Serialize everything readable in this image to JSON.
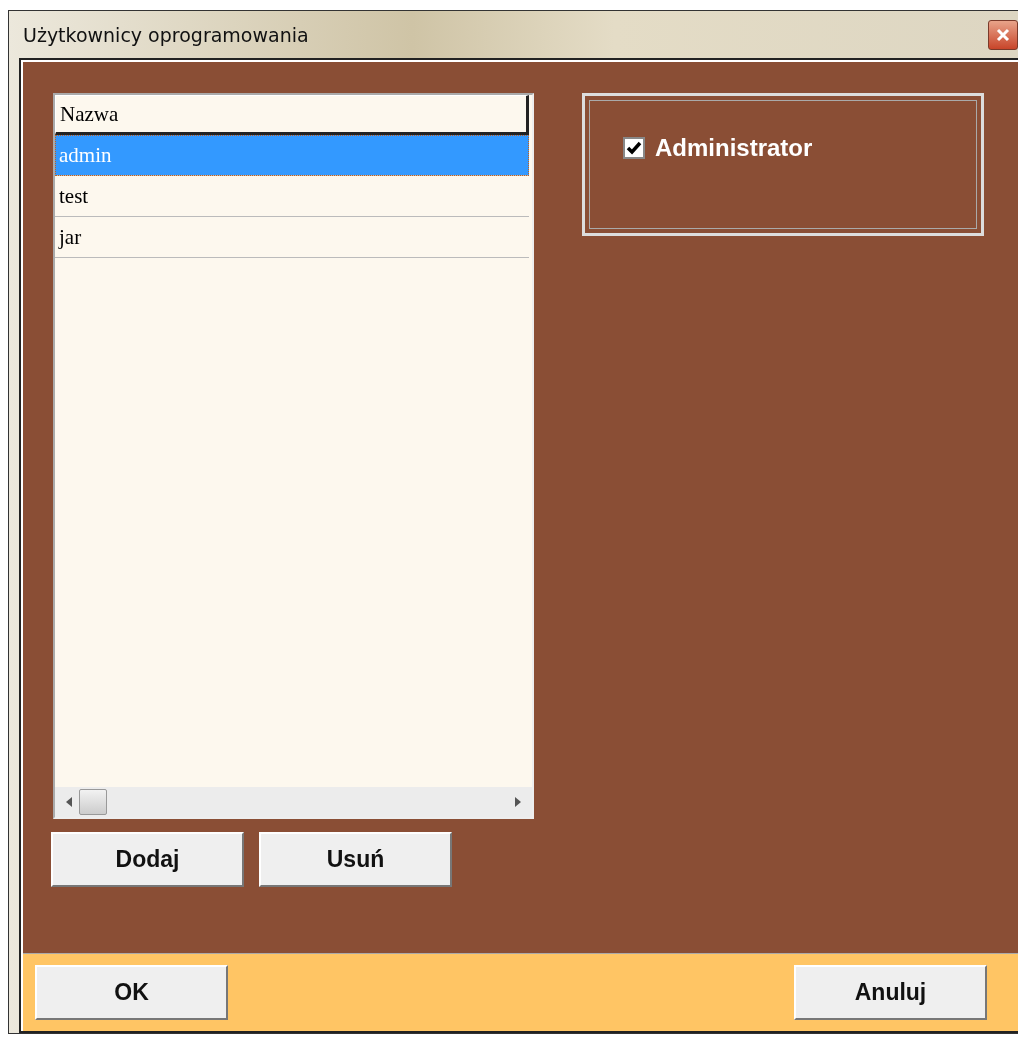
{
  "window": {
    "title": "Użytkownicy oprogramowania"
  },
  "users_list": {
    "column": "Nazwa",
    "rows": [
      {
        "name": "admin",
        "selected": true
      },
      {
        "name": "test",
        "selected": false
      },
      {
        "name": "jar",
        "selected": false
      }
    ]
  },
  "list_buttons": [
    "Dodaj",
    "Usuń"
  ],
  "administrator": {
    "label": "Administrator",
    "checked": true
  },
  "footer_buttons": [
    "OK",
    "Anuluj"
  ]
}
